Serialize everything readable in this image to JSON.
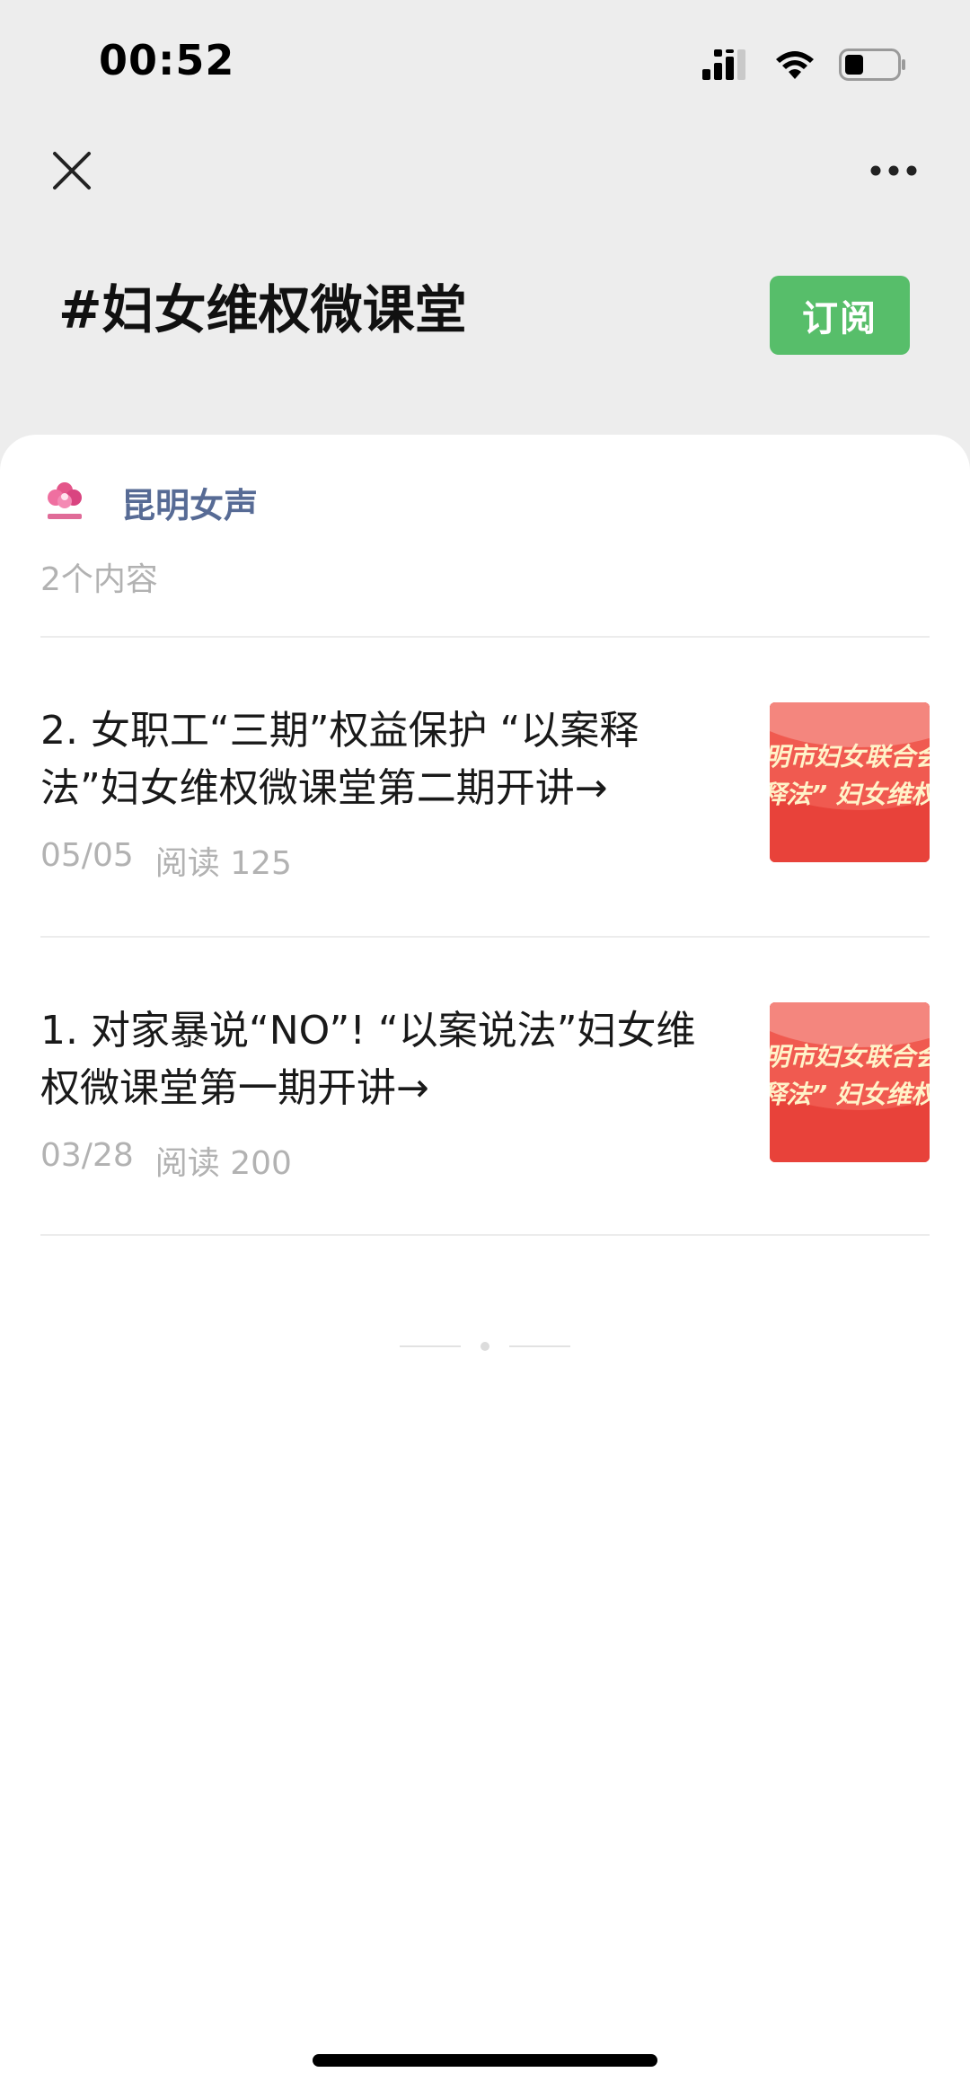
{
  "status_bar": {
    "time": "00:52"
  },
  "header": {
    "title": "#妇女维权微课堂",
    "subscribe_label": "订阅"
  },
  "account": {
    "name": "昆明女声",
    "content_count": "2个内容",
    "avatar_icon": "flower-logo-icon"
  },
  "articles": [
    {
      "title": "2. 女职工“三期”权益保护 “以案释法”妇女维权微课堂第二期开讲→",
      "date": "05/05",
      "reads": "阅读 125",
      "thumb_line1": "明市妇女联合会",
      "thumb_line2": "释法” 妇女维权"
    },
    {
      "title": "1. 对家暴说“NO”! “以案说法”妇女维权微课堂第一期开讲→",
      "date": "03/28",
      "reads": "阅读 200",
      "thumb_line1": "明市妇女联合会",
      "thumb_line2": "释法” 妇女维权"
    }
  ],
  "colors": {
    "subscribe": "#57be6a",
    "account_name": "#576b95",
    "thumb_red": "#e8423a"
  }
}
